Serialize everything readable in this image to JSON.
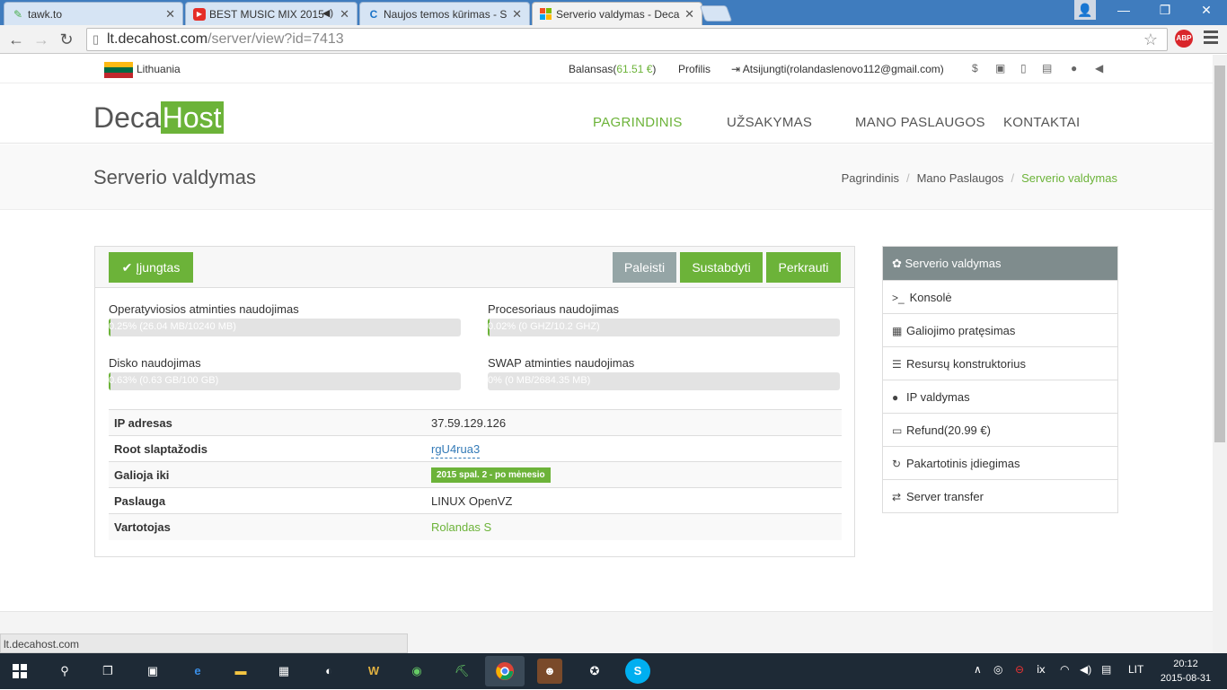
{
  "browser": {
    "tabs": [
      {
        "title": "tawk.to",
        "icon": "tawk-icon"
      },
      {
        "title": "BEST MUSIC MIX 2015",
        "icon": "youtube-icon"
      },
      {
        "title": "Naujos temos kūrimas - S",
        "icon": "forum-icon"
      },
      {
        "title": "Serverio valdymas - Deca",
        "icon": "decahost-icon"
      }
    ],
    "url_host": "lt.decahost.com",
    "url_path": "/server/view?id=7413",
    "abp_label": "ABP",
    "status_url": "lt.decahost.com"
  },
  "topbar": {
    "country": "Lithuania",
    "balance_prefix": "Balansas(",
    "balance_amount": "61.51 €",
    "balance_suffix": ")",
    "profile": "Profilis",
    "logout": "Atsijungti(rolandaslenovo112@gmail.com)",
    "flag_colors": [
      "#fdb913",
      "#006a44",
      "#c1272d"
    ]
  },
  "logo": {
    "part1": "Deca",
    "part2": "Host"
  },
  "nav": [
    "PAGRINDINIS",
    "UŽSAKYMAS",
    "MANO PASLAUGOS",
    "KONTAKTAI"
  ],
  "page": {
    "title": "Serverio valdymas",
    "breadcrumb": [
      "Pagrindinis",
      "Mano Paslaugos",
      "Serverio valdymas"
    ],
    "breadcrumb_sep": "/"
  },
  "server": {
    "status_label": "Įjungtas",
    "actions": [
      "Paleisti",
      "Sustabdyti",
      "Perkrauti"
    ],
    "usage": [
      {
        "label": "Operatyviosios atminties naudojimas",
        "text": "0.25% (26.04 MB/10240 MB)",
        "percent": 0.25
      },
      {
        "label": "Procesoriaus naudojimas",
        "text": "0.02% (0 GHZ/10.2 GHZ)",
        "percent": 0.02
      },
      {
        "label": "Disko naudojimas",
        "text": "0.63% (0.63 GB/100 GB)",
        "percent": 0.63
      },
      {
        "label": "SWAP atminties naudojimas",
        "text": "0% (0 MB/2684.35 MB)",
        "percent": 0
      }
    ],
    "info": {
      "ip_label": "IP adresas",
      "ip": "37.59.129.126",
      "root_label": "Root slaptažodis",
      "root": "rgU4rua3",
      "valid_label": "Galioja iki",
      "valid": "2015 spal. 2 - po mėnesio",
      "service_label": "Paslauga",
      "service": "LINUX OpenVZ",
      "user_label": "Vartotojas",
      "user": "Rolandas S"
    }
  },
  "sidebar": {
    "title": "Serverio valdymas",
    "items": [
      {
        "label": "Konsolė",
        "icon": ">_"
      },
      {
        "label": "Galiojimo pratęsimas",
        "icon": "calendar-icon"
      },
      {
        "label": "Resursų konstruktorius",
        "icon": "sliders-icon"
      },
      {
        "label": "IP valdymas",
        "icon": "globe-icon"
      },
      {
        "label": "Refund(20.99 €)",
        "icon": "money-icon"
      },
      {
        "label": "Pakartotinis įdiegimas",
        "icon": "refresh-icon"
      },
      {
        "label": "Server transfer",
        "icon": "exchange-icon"
      }
    ]
  },
  "taskbar": {
    "language": "LIT",
    "time": "20:12",
    "date": "2015-08-31"
  },
  "colors": {
    "accent": "#6cb339",
    "gray_button": "#95a5a6",
    "sidebar_head": "#7f8c8d"
  }
}
